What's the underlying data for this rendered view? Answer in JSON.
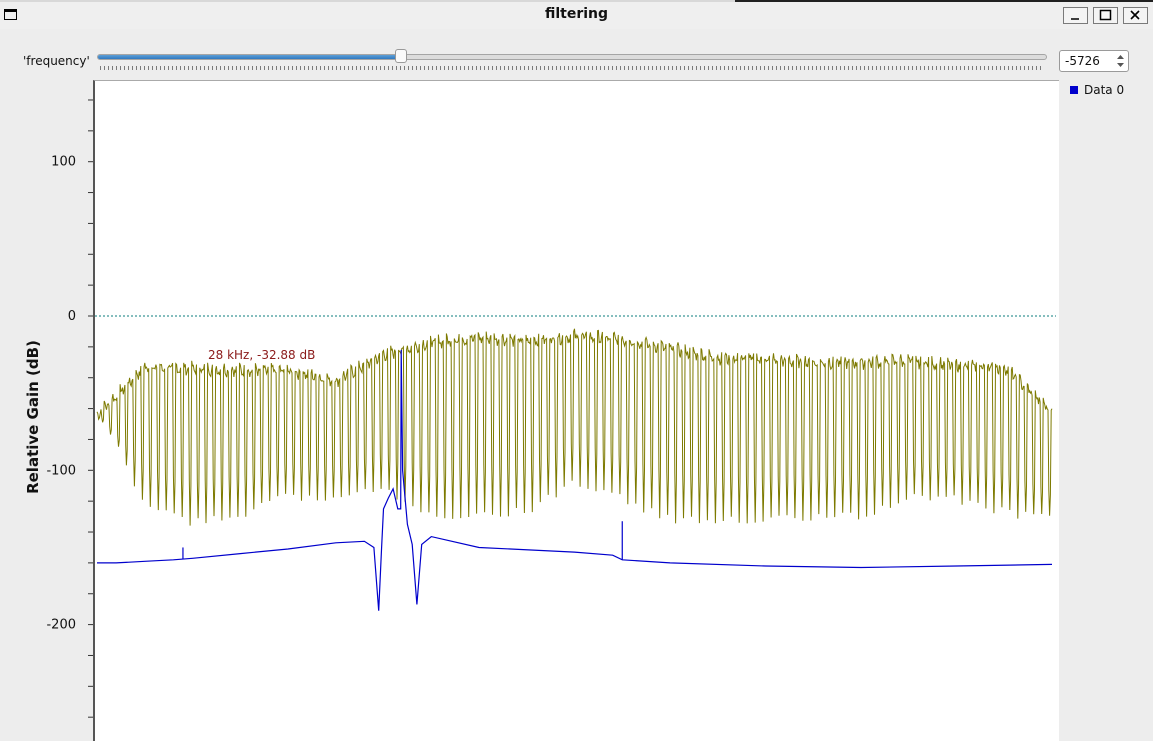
{
  "window": {
    "title": "filtering",
    "buttons": [
      "minimize",
      "maximize",
      "close"
    ]
  },
  "controls": {
    "frequency_label": "'frequency'",
    "frequency_value": "-5726",
    "slider_fraction": 0.32
  },
  "legend": {
    "items": [
      {
        "label": "Data 0",
        "color": "#0000cc"
      }
    ]
  },
  "colors": {
    "series_primary": "#0000cc",
    "series_overlay": "#7d7a00",
    "reference_line": "#0b7e7e",
    "marker_text": "#8b1a1a",
    "slider_accent": "#3b86cc"
  },
  "chart_data": {
    "type": "line",
    "title": "",
    "xlabel": "",
    "ylabel": "Relative Gain (dB)",
    "ylim": [
      -265,
      150
    ],
    "yticks": [
      100,
      0,
      -100,
      -200
    ],
    "y_tick_labels": [
      "100",
      "0",
      "-100",
      "-200"
    ],
    "x_tick_labels": [],
    "reference_line": {
      "y": 0,
      "style": "dotted"
    },
    "annotation": {
      "text": "28 kHz, -32.88 dB",
      "x": 0.2,
      "y": -32.88
    },
    "series": [
      {
        "name": "Data 0",
        "note": "blue trace",
        "x": [
          0,
          0.02,
          0.05,
          0.08,
          0.1,
          0.15,
          0.2,
          0.25,
          0.28,
          0.29,
          0.295,
          0.298,
          0.3,
          0.305,
          0.31,
          0.315,
          0.318,
          0.3185,
          0.32,
          0.325,
          0.33,
          0.335,
          0.34,
          0.35,
          0.4,
          0.5,
          0.54,
          0.55,
          0.6,
          0.7,
          0.8,
          0.9,
          1.0
        ],
        "y": [
          -160,
          -160,
          -159,
          -158,
          -157,
          -154,
          -151,
          -147,
          -146,
          -150,
          -191,
          -150,
          -125,
          -118,
          -112,
          -125,
          -125,
          -22,
          -100,
          -135,
          -148,
          -187,
          -148,
          -143,
          -150,
          -153,
          -155,
          -158,
          -160,
          -162,
          -163,
          -162,
          -161
        ]
      },
      {
        "name": "",
        "note": "olive trace (ripple between roughly -140 and -12 dB)",
        "x": [
          0,
          0.05,
          0.1,
          0.15,
          0.2,
          0.25,
          0.3,
          0.35,
          0.4,
          0.45,
          0.5,
          0.55,
          0.6,
          0.65,
          0.7,
          0.75,
          0.8,
          0.85,
          0.9,
          0.95,
          1.0
        ],
        "y_upper": [
          -62,
          -31,
          -32,
          -33,
          -33,
          -40,
          -23,
          -15,
          -12,
          -14,
          -11,
          -13,
          -19,
          -25,
          -26,
          -28,
          -28,
          -27,
          -30,
          -31,
          -60
        ],
        "y_lower": [
          -62,
          -125,
          -137,
          -132,
          -120,
          -120,
          -115,
          -134,
          -130,
          -130,
          -110,
          -122,
          -135,
          -135,
          -135,
          -133,
          -133,
          -120,
          -122,
          -130,
          -135
        ]
      }
    ]
  }
}
